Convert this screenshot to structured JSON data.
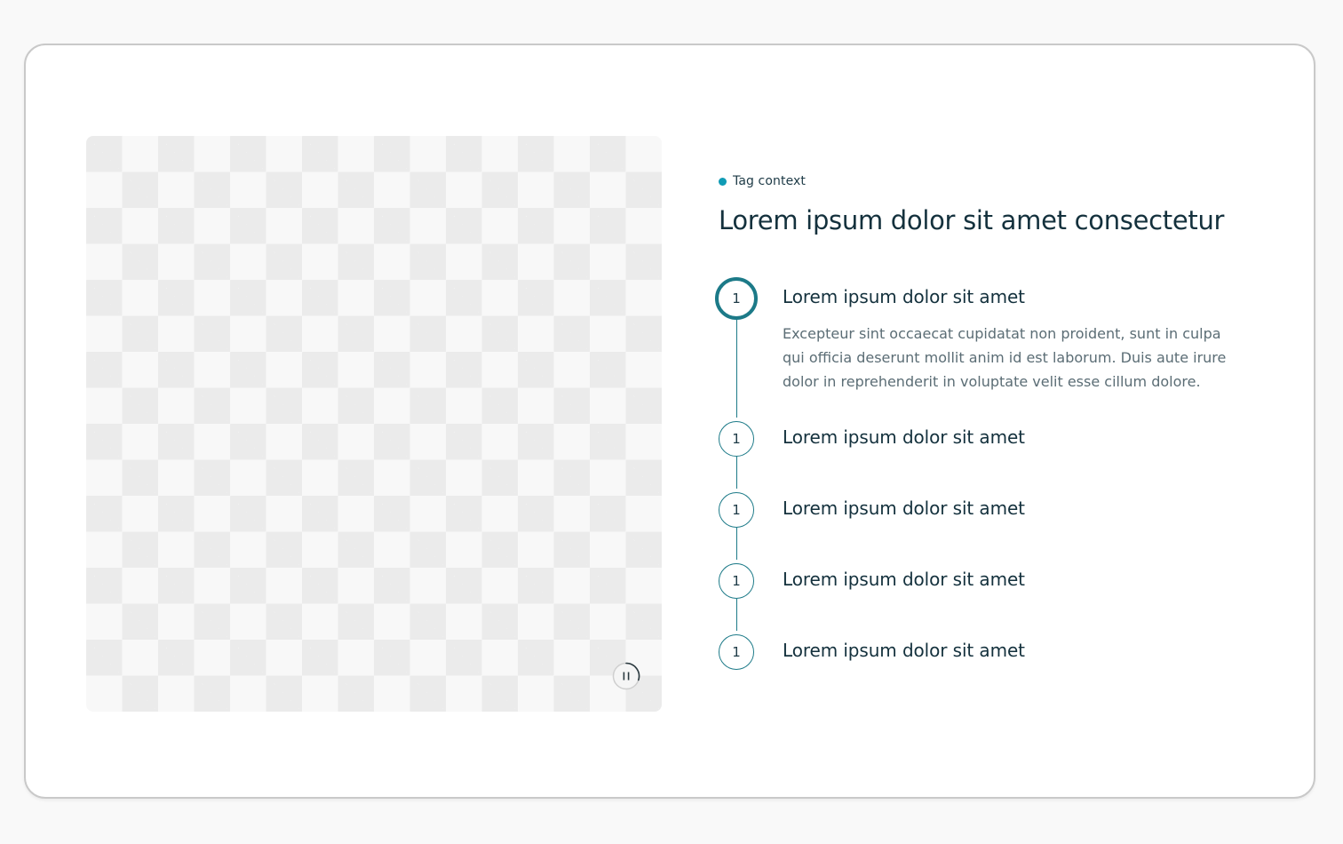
{
  "tag": {
    "label": "Tag context"
  },
  "headline": "Lorem ipsum dolor sit amet consectetur",
  "steps": [
    {
      "number": "1",
      "title": "Lorem ipsum dolor sit amet",
      "description": "Excepteur sint occaecat cupidatat non proident, sunt in culpa qui officia deserunt mollit anim id est laborum. Duis aute irure dolor in reprehenderit in voluptate velit esse cillum dolore.",
      "active": true
    },
    {
      "number": "1",
      "title": "Lorem ipsum dolor sit amet",
      "active": false
    },
    {
      "number": "1",
      "title": "Lorem ipsum dolor sit amet",
      "active": false
    },
    {
      "number": "1",
      "title": "Lorem ipsum dolor sit amet",
      "active": false
    },
    {
      "number": "1",
      "title": "Lorem ipsum dolor sit amet",
      "active": false
    }
  ],
  "media": {
    "pause_icon": "pause-icon",
    "progress": 0.3
  },
  "colors": {
    "accent": "#1c7a88",
    "tag_dot": "#0f9bb5",
    "text": "#14313d",
    "muted_text": "#5b6d75"
  }
}
